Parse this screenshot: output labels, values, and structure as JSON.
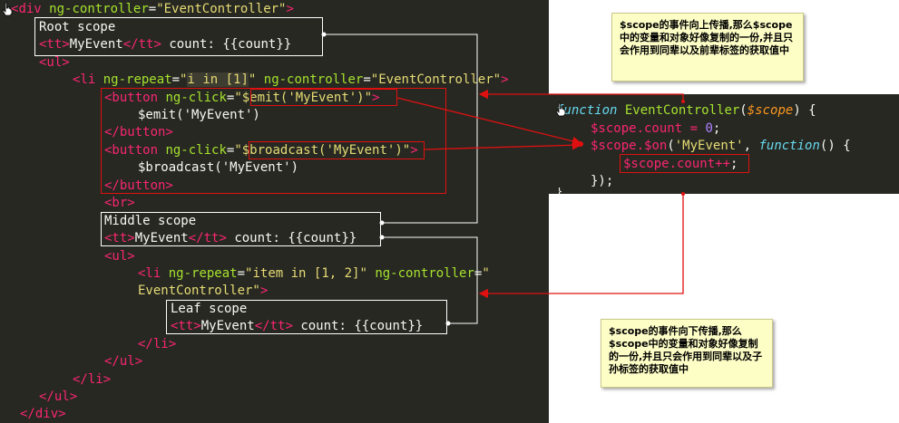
{
  "left_code": {
    "l1": {
      "t1": "<",
      "t2": "div",
      "t3": " ",
      "t4": "ng-controller",
      "t5": "=",
      "t6": "\"EventController\"",
      "t7": ">"
    },
    "l2": {
      "t1": "Root scope"
    },
    "l3": {
      "t1": "<tt>",
      "t2": "MyEvent",
      "t3": "</tt>",
      "t4": " count: {{count}}"
    },
    "l4": {
      "t1": "<ul>"
    },
    "l5": {
      "t1": "<li",
      "t2": " ng-repeat",
      "t3": "=",
      "t4": "\"",
      "t5": "i in [1]",
      "t6": "\"",
      "t7": " ng-controller",
      "t8": "=",
      "t9": "\"EventController\"",
      "t10": ">"
    },
    "l6": {
      "t1": "<button",
      "t2": " ng-click",
      "t3": "=",
      "t4": "\"",
      "t5": "$emit('MyEvent')",
      "t6": "\"",
      "t7": ">"
    },
    "l7": {
      "t1": "$emit('MyEvent')"
    },
    "l8": {
      "t1": "</button>"
    },
    "l9": {
      "t1": "<button",
      "t2": " ng-click",
      "t3": "=",
      "t4": "\"",
      "t5": "$broadcast('MyEvent')",
      "t6": "\"",
      "t7": ">"
    },
    "l10": {
      "t1": "$broadcast('MyEvent')"
    },
    "l11": {
      "t1": "</button>"
    },
    "l12": {
      "t1": "<br>"
    },
    "l13": {
      "t1": "Middle scope"
    },
    "l14": {
      "t1": "<tt>",
      "t2": "MyEvent",
      "t3": "</tt>",
      "t4": " count: {{count}}"
    },
    "l15": {
      "t1": "<ul>"
    },
    "l16": {
      "t1": "<li",
      "t2": " ng-repeat",
      "t3": "=",
      "t4": "\"item in [1, 2]\"",
      "t5": " ng-controller",
      "t6": "=",
      "t7": "\""
    },
    "l17": {
      "t1": "EventController\"",
      "t2": ">"
    },
    "l18": {
      "t1": "Leaf scope"
    },
    "l19": {
      "t1": "<tt>",
      "t2": "MyEvent",
      "t3": "</tt>",
      "t4": " count: {{count}}"
    },
    "l20": {
      "t1": "</li>"
    },
    "l21": {
      "t1": "</ul>"
    },
    "l22": {
      "t1": "</li>"
    },
    "l23": {
      "t1": "</ul>"
    },
    "l24": {
      "t1": "</div>"
    }
  },
  "right_code": {
    "r1": {
      "kw": "function",
      "fn": " EventController",
      "p1": "(",
      "param": "$scope",
      "p2": ") {"
    },
    "r2": {
      "a": "$scope.count",
      "op": " = ",
      "num": "0",
      "end": ";"
    },
    "r3": {
      "a": "$scope.",
      "fn": "$on",
      "p1": "(",
      "str": "'MyEvent'",
      "p2": ", ",
      "kw": "function",
      "p3": "() {"
    },
    "r4": {
      "a": "$scope.count",
      "op": "++",
      "end": ";"
    },
    "r5": {
      "a": "});"
    },
    "r6": {
      "a": "}"
    }
  },
  "notes": {
    "top": "$scope的事件向上传播,那么$scope中的变量和对象好像复制的一份,并且只会作用到同辈以及前辈标签的获取值中",
    "bottom": "$scope的事件向下传播,那么$scope中的变量和对象好像复制的一份,并且只会作用到同辈以及子孙标签的获取值中"
  },
  "colors": {
    "editor_bg": "#272822",
    "tag": "#f92672",
    "attribute": "#a6e22e",
    "string": "#e6db74",
    "keyword": "#66d9ef",
    "parameter": "#fd971f",
    "number": "#ae81ff",
    "annotation_red": "#e01010",
    "note_bg": "#fdfdc6"
  },
  "icons": [
    "hand-cursor-icon"
  ]
}
